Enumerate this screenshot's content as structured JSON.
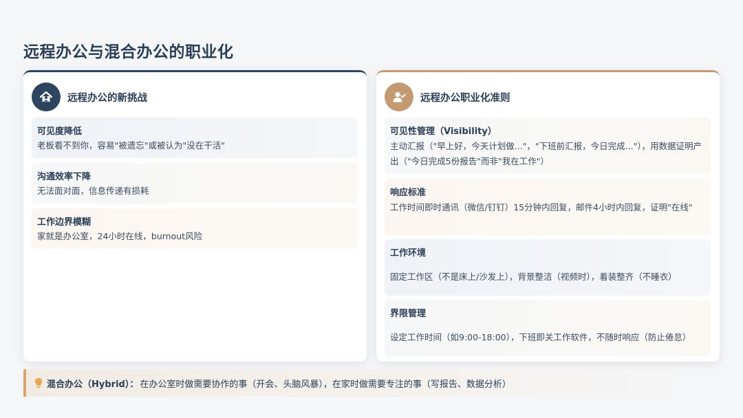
{
  "page_title": "远程办公与混合办公的职业化",
  "left_card": {
    "title": "远程办公的新挑战",
    "icon": "house-user-icon",
    "items": [
      {
        "heading": "可见度降低",
        "desc": "老板看不到你，容易\"被遗忘\"或被认为\"没在干活\""
      },
      {
        "heading": "沟通效率下降",
        "desc": "无法面对面，信息传递有损耗"
      },
      {
        "heading": "工作边界模糊",
        "desc": "家就是办公室，24小时在线，burnout风险"
      }
    ]
  },
  "right_card": {
    "title": "远程办公职业化准则",
    "icon": "user-check-icon",
    "items": [
      {
        "heading": "可见性管理（Visibility）",
        "desc": "主动汇报（\"早上好，今天计划做...\"，\"下班前汇报，今日完成...\"），用数据证明产出（\"今日完成5份报告\"而非\"我在工作\"）"
      },
      {
        "heading": "响应标准",
        "desc": "工作时间即时通讯（微信/钉钉）15分钟内回复，邮件4小时内回复，证明\"在线\""
      },
      {
        "heading": "工作环境",
        "desc": "固定工作区（不是床上/沙发上），背景整洁（视频时），着装整齐（不睡衣）"
      },
      {
        "heading": "界限管理",
        "desc": "设定工作时间（如9:00-18:00），下班即关工作软件，不随时响应（防止倦怠）"
      }
    ]
  },
  "tip": {
    "icon": "lightbulb-icon",
    "label": "混合办公（Hybrid）：",
    "text": "在办公室时做需要协作的事（开会、头脑风暴），在家时做需要专注的事（写报告、数据分析）"
  },
  "colors": {
    "navy": "#2e4560",
    "tan": "#c49a72",
    "accent": "#d9a56b"
  }
}
